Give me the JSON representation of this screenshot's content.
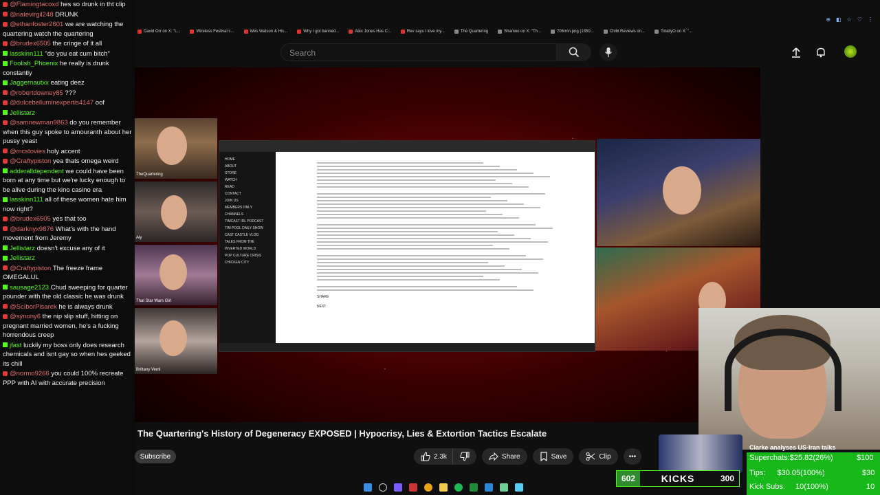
{
  "browser": {
    "bookmarks": [
      {
        "label": "David Orr on X: \"L...",
        "color": "#d33"
      },
      {
        "label": "Wireless Festival c...",
        "color": "#d33"
      },
      {
        "label": "Wes Watson & His...",
        "color": "#d33"
      },
      {
        "label": "Why I got banned...",
        "color": "#d33"
      },
      {
        "label": "Alex Jones Has C...",
        "color": "#d33"
      },
      {
        "label": "Rev says I love my...",
        "color": "#d33"
      },
      {
        "label": "The Quartering",
        "color": "#888"
      },
      {
        "label": "Shamoo on X: \"Th...",
        "color": "#888"
      },
      {
        "label": "706nnn.png (1350...",
        "color": "#888"
      },
      {
        "label": "Chibi Reviews on...",
        "color": "#888"
      },
      {
        "label": "TotallyO on X: \"...",
        "color": "#888"
      }
    ]
  },
  "header": {
    "search_placeholder": "Search"
  },
  "video": {
    "title": "The Quartering's History of Degeneracy EXPOSED | Hypocrisy, Lies & Extortion Tactics Escalate",
    "subscribe_label": "Subscribe",
    "likes": "2.3k",
    "share_label": "Share",
    "save_label": "Save",
    "clip_label": "Clip",
    "more_label": "•••"
  },
  "cams": {
    "cam1_label": "TheQuartering",
    "cam2_label": "Aly",
    "cam3_label": "That Star Wars Girl",
    "cam4_label": "Brittany Venti"
  },
  "screen_share": {
    "sidebar": [
      "HOME",
      "ABOUT",
      "STORE",
      "WATCH",
      "READ",
      "CONTACT",
      "JOIN US",
      "MEMBERS ONLY",
      "CHANNELS",
      "TIMCAST IRL PODCAST",
      "TIM POOL DAILY SHOW",
      "CAST CASTLE VLOG",
      "TALES FROM THE INVERTED WORLD",
      "POP CULTURE CRISIS",
      "CHICKEN CITY"
    ],
    "share_label": "SHARE",
    "next_label": "NEXT"
  },
  "chat": [
    {
      "platform": "yt",
      "user": "@Flamingtacoxd",
      "text": "hes so drunk in tht clip"
    },
    {
      "platform": "yt",
      "user": "@natevirgil248",
      "text": "DRUNK"
    },
    {
      "platform": "yt",
      "user": "@ethanfoster2601",
      "text": "we are watching the quartering watch the quartering"
    },
    {
      "platform": "yt",
      "user": "@brudex6505",
      "text": "the cringe of it all"
    },
    {
      "platform": "kick",
      "user": "lasskinn111",
      "text": "\"do you eat cum bitch\""
    },
    {
      "platform": "kick",
      "user": "Foolish_Phoenix",
      "text": "he really is drunk constantly"
    },
    {
      "platform": "kick",
      "user": "Jaggernautxx",
      "text": "eating deez"
    },
    {
      "platform": "yt",
      "user": "@robertdowney85",
      "text": "???"
    },
    {
      "platform": "yt",
      "user": "@dulcebelluminexpertis4147",
      "text": "oof"
    },
    {
      "platform": "kick",
      "user": "Jellistarz",
      "text": ""
    },
    {
      "platform": "yt",
      "user": "@samnewman9863",
      "text": "do you remember when this guy spoke to amouranth about her pussy yeast"
    },
    {
      "platform": "yt",
      "user": "@mcstovies",
      "text": "holy accent"
    },
    {
      "platform": "yt",
      "user": "@Craftypiston",
      "text": "yea thats omega weird"
    },
    {
      "platform": "kick",
      "user": "adderalldependent",
      "text": "we could have been born at any time but we're lucky enough to be alive during the kino casino era"
    },
    {
      "platform": "kick",
      "user": "lasskinn111",
      "text": "all of these women hate him now right?"
    },
    {
      "platform": "yt",
      "user": "@brudex6505",
      "text": "yes that too"
    },
    {
      "platform": "yt",
      "user": "@darknyx9876",
      "text": "What's with the hand movement from Jeremy"
    },
    {
      "platform": "kick",
      "user": "Jellistarz",
      "text": "doesn't excuse any of it"
    },
    {
      "platform": "kick",
      "user": "Jellistarz",
      "text": ""
    },
    {
      "platform": "yt",
      "user": "@Craftypiston",
      "text": "The freeze frame OMEGALUL"
    },
    {
      "platform": "kick",
      "user": "sausage2123",
      "text": "Chud sweeping for quarter pounder with the old classic he was drunk"
    },
    {
      "platform": "yt",
      "user": "@ScIborPisarek",
      "text": "he is always drunk"
    },
    {
      "platform": "yt",
      "user": "@synony6",
      "text": "the nip slip stuff, hitting on pregnant married women, he's a fucking horrendous creep"
    },
    {
      "platform": "kick",
      "user": "jfast",
      "text": "luckily my boss only does research chemicals and isnt gay so when hes geeked its chill"
    },
    {
      "platform": "yt",
      "user": "@normo9266",
      "text": "you could 100% recreate PPP with AI with accurate precision"
    }
  ],
  "news": {
    "title": "Clarke analyses US-Iran talks"
  },
  "stats": {
    "superchats_label": "Superchats:",
    "superchats_value": "$25.82(26%)",
    "superchats_goal": "$100",
    "tips_label": "Tips:",
    "tips_value": "$30.05(100%)",
    "tips_goal": "$30",
    "kicksubs_label": "Kick Subs:",
    "kicksubs_value": "10(100%)",
    "kicksubs_goal": "10"
  },
  "kick_bar": {
    "left_count": "602",
    "logo": "KICKS",
    "right_count": "300"
  }
}
